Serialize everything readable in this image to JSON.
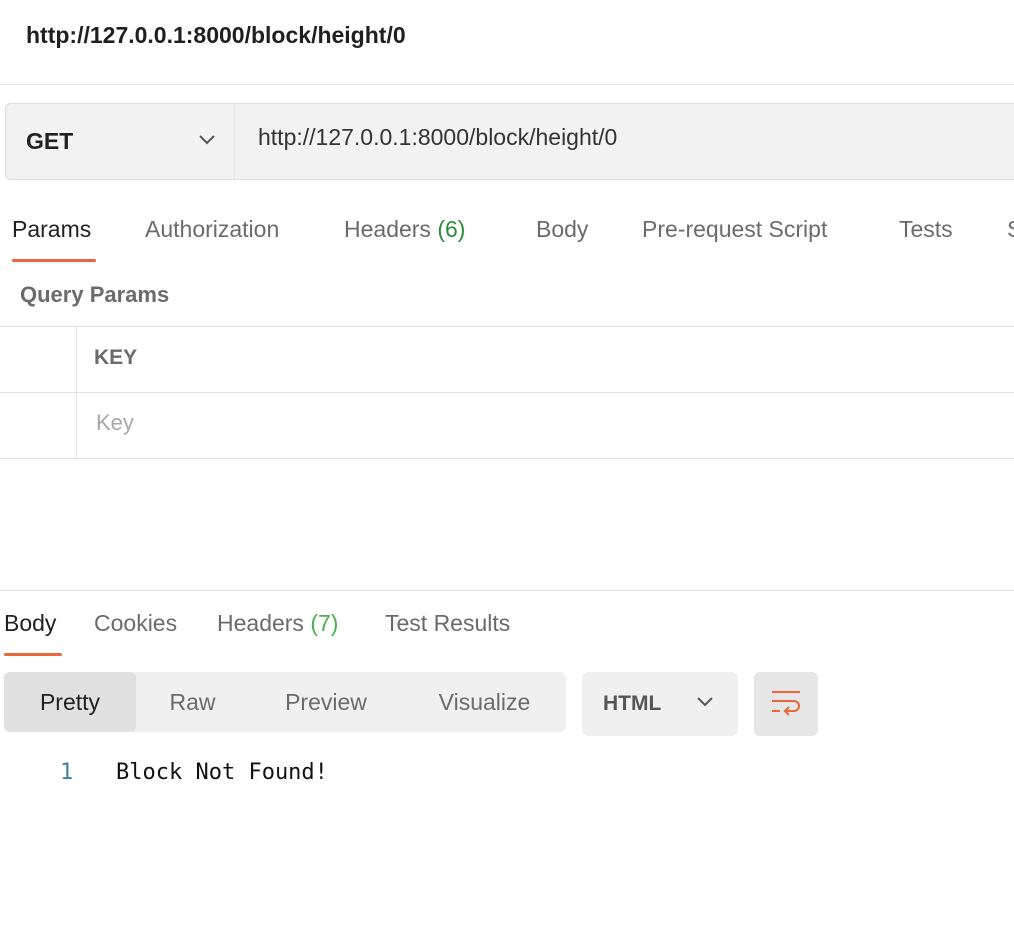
{
  "request": {
    "title": "http://127.0.0.1:8000/block/height/0",
    "method": "GET",
    "url": "http://127.0.0.1:8000/block/height/0"
  },
  "request_tabs": [
    {
      "label": "Params",
      "count": ""
    },
    {
      "label": "Authorization",
      "count": ""
    },
    {
      "label": "Headers",
      "count": "(6)"
    },
    {
      "label": "Body",
      "count": ""
    },
    {
      "label": "Pre-request Script",
      "count": ""
    },
    {
      "label": "Tests",
      "count": ""
    },
    {
      "label": "S",
      "count": ""
    }
  ],
  "params": {
    "section_label": "Query Params",
    "column_key": "KEY",
    "key_placeholder": "Key"
  },
  "response_tabs": [
    {
      "label": "Body",
      "count": ""
    },
    {
      "label": "Cookies",
      "count": ""
    },
    {
      "label": "Headers",
      "count": "(7)"
    },
    {
      "label": "Test Results",
      "count": ""
    }
  ],
  "view_modes": [
    "Pretty",
    "Raw",
    "Preview",
    "Visualize"
  ],
  "active_view_mode": "Pretty",
  "format": "HTML",
  "response_body": [
    {
      "line": "1",
      "text": "Block Not Found!"
    }
  ],
  "colors": {
    "accent": "#e8683c",
    "count_green": "#2a8f3d",
    "line_number": "#3f7fa3"
  },
  "icons": {
    "method_dropdown": "chevron-down-icon",
    "format_dropdown": "chevron-down-icon",
    "wrap": "text-wrap-icon"
  }
}
